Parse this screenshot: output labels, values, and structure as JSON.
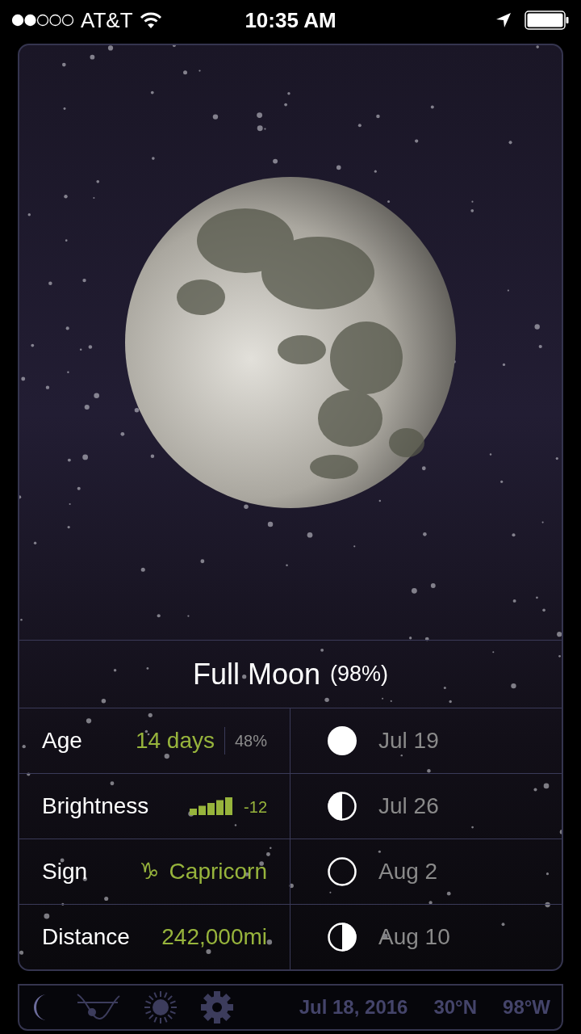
{
  "status_bar": {
    "carrier": "AT&T",
    "time": "10:35 AM"
  },
  "phase": {
    "name": "Full Moon",
    "percent": "(98%)"
  },
  "details": [
    {
      "kind": "split",
      "label": "Age",
      "value": "14 days",
      "secondary": "48%"
    },
    {
      "kind": "meter",
      "label": "Brightness",
      "value": "-12"
    },
    {
      "kind": "sign",
      "label": "Sign",
      "symbol": "♑",
      "value": "Capricorn"
    },
    {
      "kind": "plain",
      "label": "Distance",
      "value": "242,000mi"
    }
  ],
  "upcoming_phases": [
    {
      "kind": "full",
      "date": "Jul 19"
    },
    {
      "kind": "last_quarter",
      "date": "Jul 26"
    },
    {
      "kind": "new",
      "date": "Aug 2"
    },
    {
      "kind": "first_quarter",
      "date": "Aug 10"
    }
  ],
  "toolbar": {
    "tabs": [
      {
        "kind": "moon",
        "selected": true
      },
      {
        "kind": "curve",
        "selected": false
      },
      {
        "kind": "sun",
        "selected": false
      },
      {
        "kind": "settings",
        "selected": false
      }
    ],
    "date": "Jul 18, 2016",
    "latitude": "30°N",
    "longitude": "98°W"
  }
}
